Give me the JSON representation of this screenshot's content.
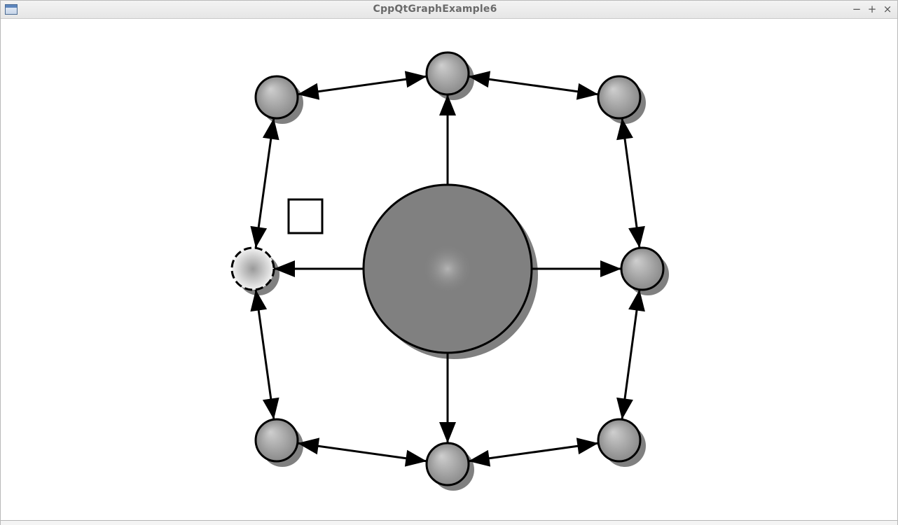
{
  "window": {
    "title": "CppQtGraphExample6",
    "controls": {
      "minimize": "−",
      "maximize": "+",
      "close": "×"
    }
  },
  "graph": {
    "colors": {
      "node_fill": "#8a8a8a",
      "node_highlight": "#cfcfcf",
      "shadow": "#808080",
      "selected_fill": "#f2f2f2",
      "selected_center": "#9a9a9a",
      "outline": "#000000",
      "center_node_fill": "#808080",
      "center_glow": "#b4b4b4"
    },
    "nodes": [
      {
        "id": "node-top-left",
        "kind": "small"
      },
      {
        "id": "node-top",
        "kind": "small"
      },
      {
        "id": "node-top-right",
        "kind": "small"
      },
      {
        "id": "node-left",
        "kind": "small",
        "selected": true
      },
      {
        "id": "node-center",
        "kind": "large"
      },
      {
        "id": "node-right",
        "kind": "small"
      },
      {
        "id": "node-bottom-left",
        "kind": "small"
      },
      {
        "id": "node-bottom",
        "kind": "small"
      },
      {
        "id": "node-bottom-right",
        "kind": "small"
      }
    ],
    "edges": [
      {
        "from": "node-top-left",
        "to": "node-top"
      },
      {
        "from": "node-top",
        "to": "node-top-right"
      },
      {
        "from": "node-top-left",
        "to": "node-left"
      },
      {
        "from": "node-top-right",
        "to": "node-right"
      },
      {
        "from": "node-left",
        "to": "node-bottom-left"
      },
      {
        "from": "node-right",
        "to": "node-bottom-right"
      },
      {
        "from": "node-bottom-left",
        "to": "node-bottom"
      },
      {
        "from": "node-bottom",
        "to": "node-bottom-right"
      },
      {
        "from": "node-top",
        "to": "node-center"
      },
      {
        "from": "node-left",
        "to": "node-center"
      },
      {
        "from": "node-right",
        "to": "node-center"
      },
      {
        "from": "node-bottom",
        "to": "node-center"
      }
    ],
    "floating_shape": {
      "kind": "empty-square"
    }
  }
}
